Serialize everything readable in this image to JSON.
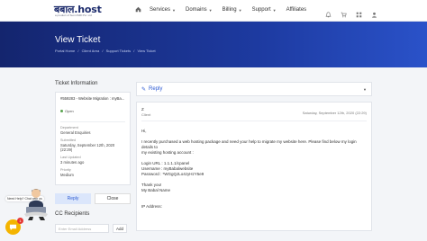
{
  "brand": {
    "logo": "बबाल.host",
    "tagline": "a product of Sumi IMR Pvt. Ltd"
  },
  "nav": {
    "items": [
      {
        "label": "Services",
        "has_caret": true
      },
      {
        "label": "Domains",
        "has_caret": true
      },
      {
        "label": "Billing",
        "has_caret": true
      },
      {
        "label": "Support",
        "has_caret": true
      },
      {
        "label": "Affiliates",
        "has_caret": false
      }
    ],
    "icons": [
      "home-icon",
      "bell-icon",
      "cart-icon",
      "grid-icon",
      "user-icon"
    ]
  },
  "banner": {
    "title": "View Ticket",
    "breadcrumb": [
      "Portal Home",
      "/",
      "Client Area",
      "/",
      "Support Tickets",
      "/",
      "View Ticket"
    ]
  },
  "sidebar": {
    "heading": "Ticket Information",
    "ticket_subject": "#559283 - Website Migration : myBa...",
    "status": "Open",
    "status_color": "#5aa44f",
    "fields": [
      {
        "label": "Department",
        "value": "General Enquiries"
      },
      {
        "label": "Submitted",
        "value": "Saturday, September 12th, 2020 (22:29)"
      },
      {
        "label": "Last Updated",
        "value": "3 minutes ago"
      },
      {
        "label": "Priority",
        "value": "Medium"
      }
    ],
    "reply_label": "Reply",
    "close_label": "Close",
    "cc_heading": "CC Recipients",
    "cc_placeholder": "Enter Email Address",
    "cc_add": "Add"
  },
  "main": {
    "reply_label": "Reply",
    "message": {
      "author": "Z",
      "role": "Client",
      "date": "Saturday, September 12th, 2020 (22:29)",
      "lines": [
        "Hi,",
        "",
        "I recently purchased a web hosting package and need your help to migrate my website here. Please find below my login details to",
        "my existing hosting account :",
        "",
        "Login URL : 1.1.1.1/cpanel",
        "Username : myBabalwebsite",
        "Password : *WGgQJLo4zyHzY5e9",
        "",
        "Thank you!",
        "My Babal Name",
        "",
        "",
        "IP Address:"
      ]
    }
  },
  "widget": {
    "need_help": "Need Help? Chat with us",
    "badge_count": "1"
  },
  "colors": {
    "accent": "#2d5bd3",
    "banner": "#1b3596",
    "chat": "#f4b400"
  }
}
